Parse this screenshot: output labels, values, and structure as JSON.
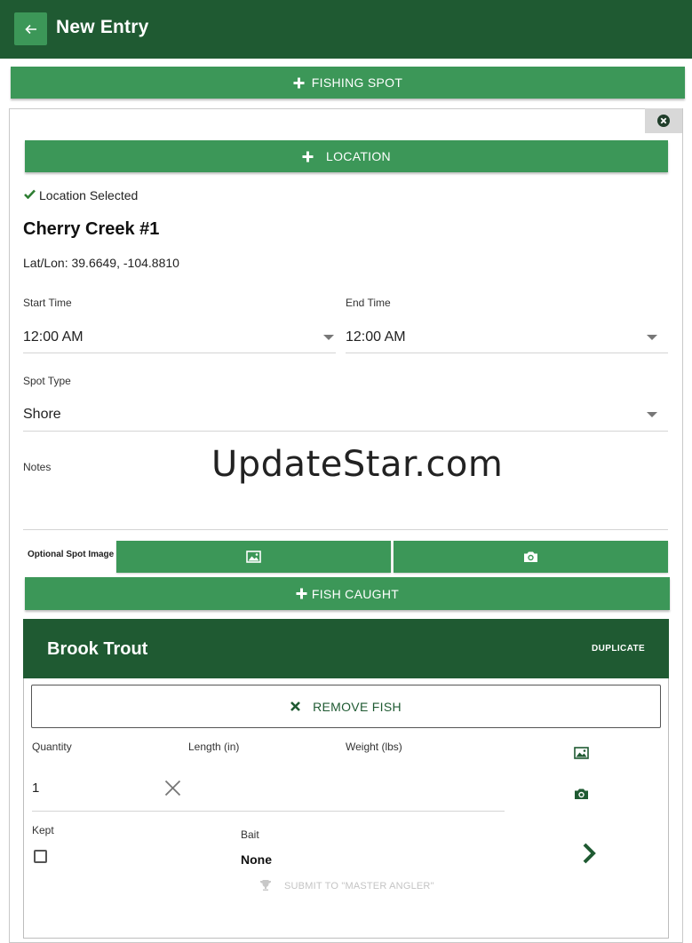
{
  "appbar": {
    "title": "New Entry"
  },
  "buttons": {
    "fishing_spot": "FISHING SPOT",
    "location": "LOCATION",
    "fish_caught": "FISH CAUGHT",
    "remove_fish": "REMOVE FISH",
    "duplicate": "DUPLICATE"
  },
  "location": {
    "status": "Location Selected",
    "name": "Cherry Creek #1",
    "latlon": "Lat/Lon: 39.6649, -104.8810"
  },
  "fields": {
    "start_time": {
      "label": "Start Time",
      "value": "12:00 AM"
    },
    "end_time": {
      "label": "End Time",
      "value": "12:00 AM"
    },
    "spot_type": {
      "label": "Spot Type",
      "value": "Shore"
    },
    "notes": {
      "label": "Notes",
      "value": ""
    },
    "spot_image": {
      "label": "Optional Spot Image"
    }
  },
  "watermark": "UpdateStar.com",
  "fish": {
    "name": "Brook Trout",
    "quantity": {
      "label": "Quantity",
      "value": "1"
    },
    "length": {
      "label": "Length (in)",
      "value": ""
    },
    "weight": {
      "label": "Weight (lbs)",
      "value": ""
    },
    "kept": {
      "label": "Kept"
    },
    "bait": {
      "label": "Bait",
      "value": "None"
    },
    "submit": "SUBMIT TO \"MASTER ANGLER\""
  },
  "colors": {
    "primary_dark": "#1f5a32",
    "primary": "#3c9758",
    "check": "#2e7d32"
  },
  "icons": [
    "back-arrow-icon",
    "plus-icon",
    "close-circle-icon",
    "check-icon",
    "image-icon",
    "camera-icon",
    "close-x-icon",
    "clear-icon",
    "trophy-icon",
    "chevron-right-icon"
  ]
}
